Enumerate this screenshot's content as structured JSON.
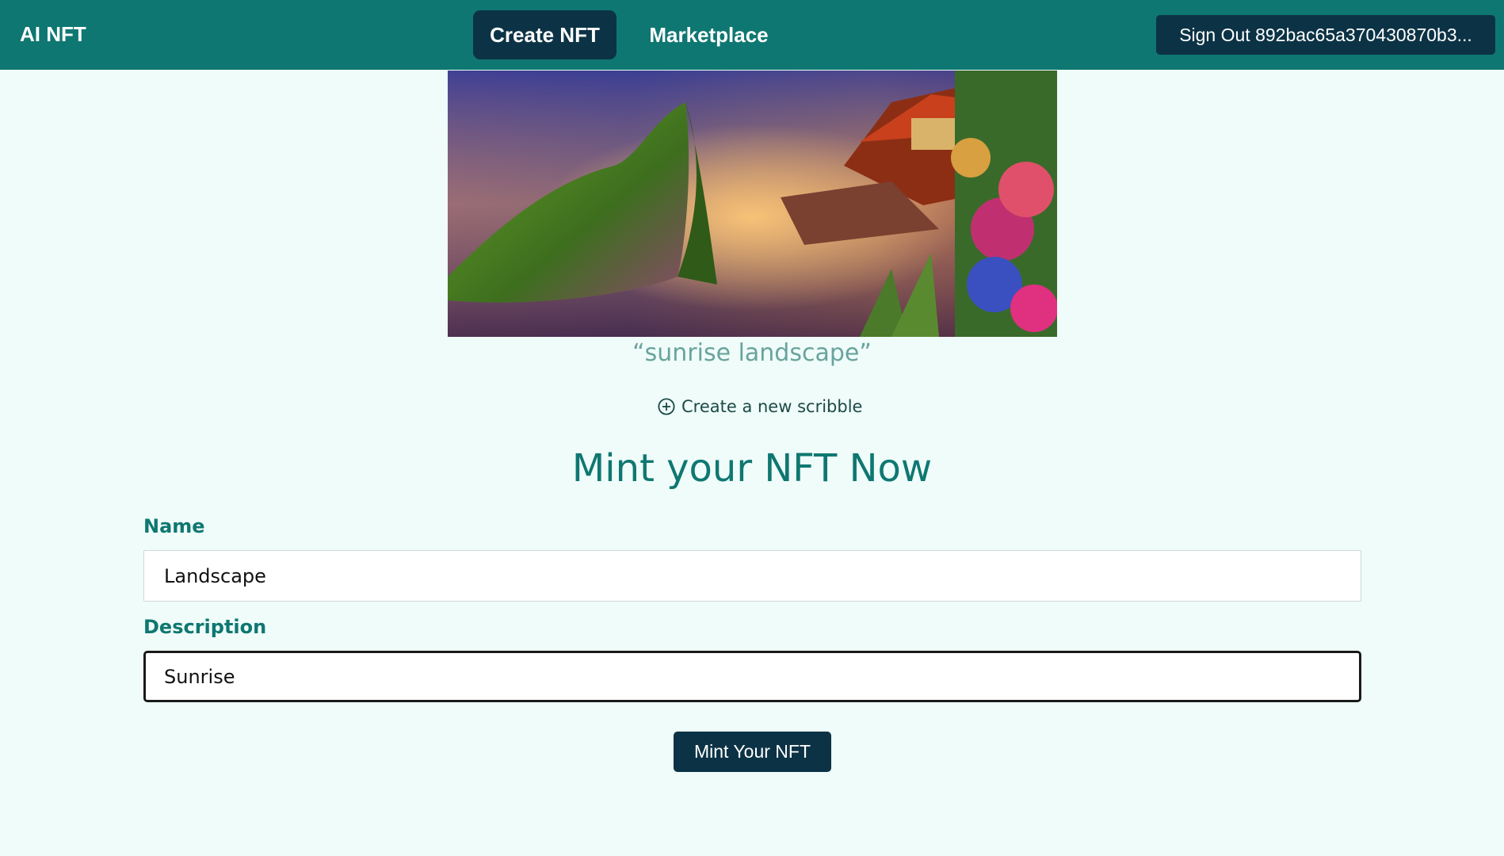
{
  "nav": {
    "brand": "AI NFT",
    "tabs": [
      "Create NFT",
      "Marketplace"
    ],
    "active_tab": "Create NFT",
    "signout_label": "Sign Out 892bac65a370430870b3..."
  },
  "artwork": {
    "prompt": "“sunrise landscape”"
  },
  "scribble": {
    "icon": "plus-circle-icon",
    "label": "Create a new scribble"
  },
  "form": {
    "heading": "Mint your NFT Now",
    "name_label": "Name",
    "name_value": "Landscape",
    "description_label": "Description",
    "description_value": "Sunrise ",
    "submit_label": "Mint Your NFT"
  },
  "colors": {
    "nav_bg": "#0f7771",
    "dark_button": "#0c3345",
    "page_bg": "#effcf9",
    "accent_text": "#0f7771"
  }
}
